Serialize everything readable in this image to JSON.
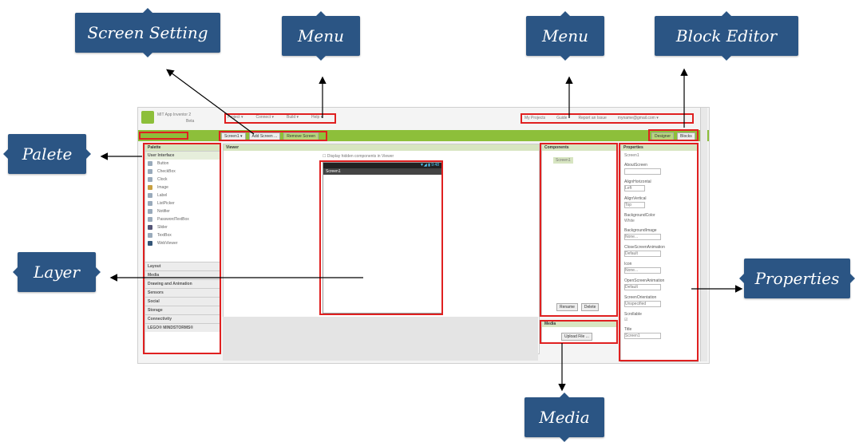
{
  "callouts": {
    "screen_setting": "Screen Setting",
    "menu_left": "Menu",
    "menu_right": "Menu",
    "block_editor": "Block Editor",
    "palete": "Palete",
    "layer": "Layer",
    "properties": "Properties",
    "media": "Media"
  },
  "app": {
    "logo_text": "MIT App Inventor 2",
    "logo_sub": "Beta",
    "top_menu": [
      "Project ▾",
      "Connect ▾",
      "Build ▾",
      "Help ▾"
    ],
    "right_menu": [
      "My Projects",
      "Guide",
      "Report an Issue",
      "myname@gmail.com ▾"
    ],
    "screen_buttons": [
      "Screen1 ▾",
      "Add Screen ...",
      "Remove Screen"
    ],
    "editor_buttons": [
      "Designer",
      "Blocks"
    ]
  },
  "palette": {
    "title": "Palette",
    "group": "User Interface",
    "items": [
      "Button",
      "CheckBox",
      "Clock",
      "Image",
      "Label",
      "ListPicker",
      "Notifier",
      "PasswordTextBox",
      "Slider",
      "TextBox",
      "WebViewer"
    ],
    "sections": [
      "Layout",
      "Media",
      "Drawing and Animation",
      "Sensors",
      "Social",
      "Storage",
      "Connectivity",
      "LEGO® MINDSTORMS®"
    ]
  },
  "viewer": {
    "title": "Viewer",
    "checkbox_label": "Display hidden components in Viewer",
    "phone_title": "Screen1",
    "status": "▼◢ ▮ 9:48"
  },
  "components": {
    "title": "Components",
    "root": "Screen1",
    "rename": "Rename",
    "delete": "Delete"
  },
  "media": {
    "title": "Media",
    "upload": "Upload File ..."
  },
  "properties": {
    "title": "Properties",
    "component": "Screen1",
    "fields": [
      {
        "label": "AboutScreen",
        "value": ""
      },
      {
        "label": "AlignHorizontal",
        "value": "Left"
      },
      {
        "label": "AlignVertical",
        "value": "Top"
      },
      {
        "label": "BackgroundColor",
        "value": "White"
      },
      {
        "label": "BackgroundImage",
        "value": "None..."
      },
      {
        "label": "CloseScreenAnimation",
        "value": "Default"
      },
      {
        "label": "Icon",
        "value": "None..."
      },
      {
        "label": "OpenScreenAnimation",
        "value": "Default"
      },
      {
        "label": "ScreenOrientation",
        "value": "Unspecified"
      },
      {
        "label": "Scrollable",
        "value": ""
      },
      {
        "label": "Title",
        "value": "Screen1"
      }
    ]
  },
  "colors": {
    "callout": "#2b5584",
    "highlight": "#e02020",
    "green_bar": "#8dbf3a",
    "panel_head": "#d7e5c1"
  }
}
